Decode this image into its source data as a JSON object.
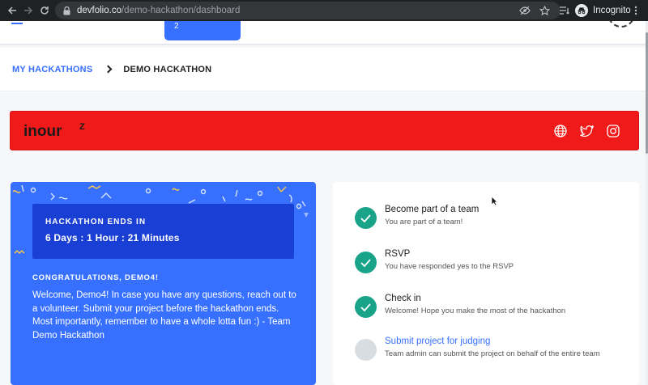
{
  "browser": {
    "url_host": "devfolio.co",
    "url_path": "/demo-hackathon/dashboard",
    "profile_label": "Incognito"
  },
  "page": {
    "tab_badge": "2",
    "breadcrumb": {
      "root": "MY HACKATHONS",
      "current": "DEMO HACKATHON"
    },
    "banner": {
      "brand": "inour",
      "brand_superscript": "Z",
      "color": "#f11a1a"
    },
    "hero": {
      "ends_label": "HACKATHON ENDS IN",
      "ends_time": "6 Days : 1 Hour : 21 Minutes",
      "congrats": "CONGRATULATIONS, DEMO4!",
      "welcome": "Welcome, Demo4! In case you have any questions, reach out to a volunteer. Submit your project before the hackathon ends. Most importantly, remember to have a whole lotta fun :) - Team Demo Hackathon",
      "color": "#3770ff"
    },
    "steps": [
      {
        "title": "Become part of a team",
        "desc": "You are part of a team!",
        "status": "done"
      },
      {
        "title": "RSVP",
        "desc": "You have responded yes to the RSVP",
        "status": "done"
      },
      {
        "title": "Check in",
        "desc": "Welcome! Hope you make the most of the hackathon",
        "status": "done"
      },
      {
        "title": "Submit project for judging",
        "desc": "Team admin can submit the project on behalf of the entire team",
        "status": "todo"
      }
    ]
  },
  "colors": {
    "accent": "#3770ff",
    "success": "#19a48a",
    "pending": "#d8dde1"
  }
}
